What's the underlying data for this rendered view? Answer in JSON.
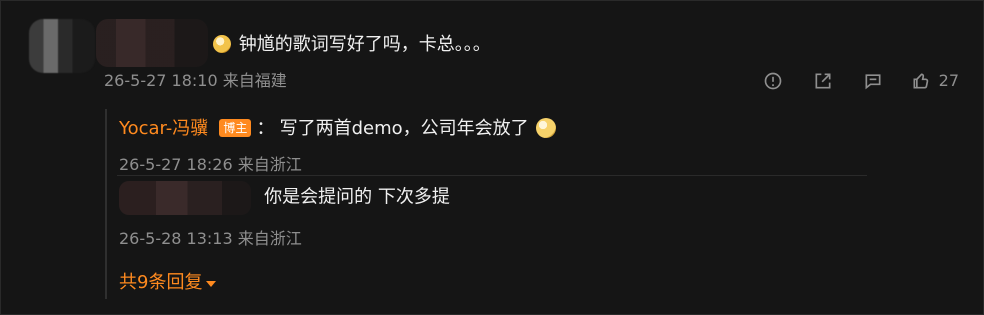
{
  "comment": {
    "emoji_icon": "grinning-cat-emoji-icon",
    "text": "钟馗的歌词写好了吗，卡总。。。",
    "meta": "26-5-27 18:10 来自福建",
    "actions": {
      "report_icon": "alert-circle-icon",
      "share_icon": "share-arrow-box-icon",
      "reply_icon": "chat-bubble-icon",
      "like_icon": "thumbs-up-icon",
      "like_count": "27"
    }
  },
  "replies": [
    {
      "user": "Yocar-冯骥",
      "badge": "博主",
      "colon": "：",
      "text": "写了两首demo，公司年会放了",
      "emoji": "smile-emoji-icon",
      "meta": "26-5-27 18:26 来自浙江"
    },
    {
      "text": "你是会提问的  下次多提",
      "meta": "26-5-28 13:13 来自浙江"
    }
  ],
  "more_replies": {
    "label": "共9条回复",
    "icon": "caret-down-icon"
  },
  "colors": {
    "background": "#151515",
    "primary_text": "#f0f0f0",
    "secondary_text": "#8f8f8f",
    "accent": "#ff8a1f"
  }
}
